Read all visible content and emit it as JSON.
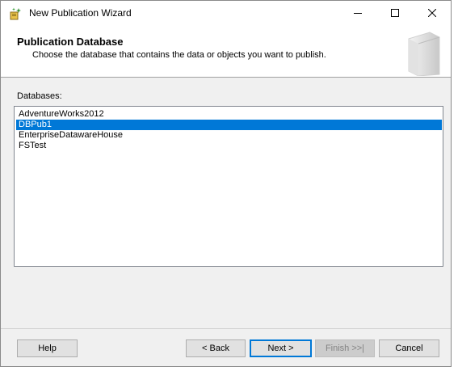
{
  "window": {
    "title": "New Publication Wizard",
    "icon": "wizard-star-icon"
  },
  "caption_buttons": {
    "minimize_icon": "minimize-icon",
    "maximize_icon": "maximize-icon",
    "close_icon": "close-icon"
  },
  "header": {
    "title": "Publication Database",
    "subtitle": "Choose the database that contains the data or objects you want to publish.",
    "art_icon": "book-icon"
  },
  "databases": {
    "label": "Databases:",
    "items": [
      "AdventureWorks2012",
      "DBPub1",
      "EnterpriseDatawareHouse",
      "FSTest"
    ],
    "selected": "DBPub1"
  },
  "buttons": {
    "help": "Help",
    "back": "< Back",
    "next": "Next >",
    "finish": "Finish >>|",
    "cancel": "Cancel"
  },
  "colors": {
    "selection": "#0078d7",
    "default_button_border": "#0078d7"
  }
}
